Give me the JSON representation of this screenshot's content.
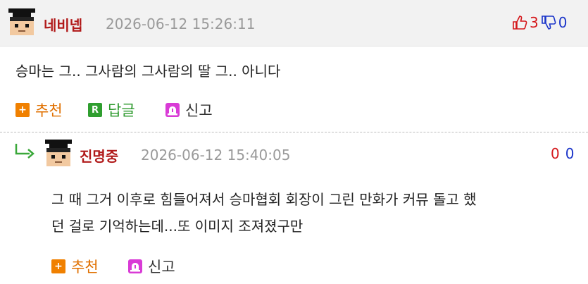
{
  "comment1": {
    "nickname": "네비넵",
    "timestamp": "2026-06-12 15:26:11",
    "upvotes": "3",
    "downvotes": "0",
    "text": "승마는 그.. 그사람의 그사람의 딸 그.. 아니다",
    "actions": {
      "recommend": "추천",
      "reply": "답글",
      "report": "신고"
    }
  },
  "comment2": {
    "nickname": "진명중",
    "timestamp": "2026-06-12 15:40:05",
    "upvotes": "0",
    "downvotes": "0",
    "text_lines": [
      "그 때 그거 이후로 힘들어져서 승마협회 회장이 그린 만화가 커뮤 돌고 했",
      "던 걸로 기억하는데...또 이미지 조져졌구만"
    ],
    "actions": {
      "recommend": "추천",
      "report": "신고"
    }
  },
  "colors": {
    "nickname": "#b11a1a",
    "upvote": "#d4161a",
    "downvote": "#1a34c9",
    "recommend": "#e07000",
    "reply": "#2e9a2e",
    "report_icon": "#d93bd6"
  },
  "icons": {
    "avatar": "scholar-avatar-icon",
    "thumbs_up": "thumbs-up-icon",
    "thumbs_down": "thumbs-down-icon",
    "recommend": "plus-icon",
    "reply": "r-icon",
    "report": "siren-icon",
    "reply_indicator": "reply-arrow-icon"
  }
}
